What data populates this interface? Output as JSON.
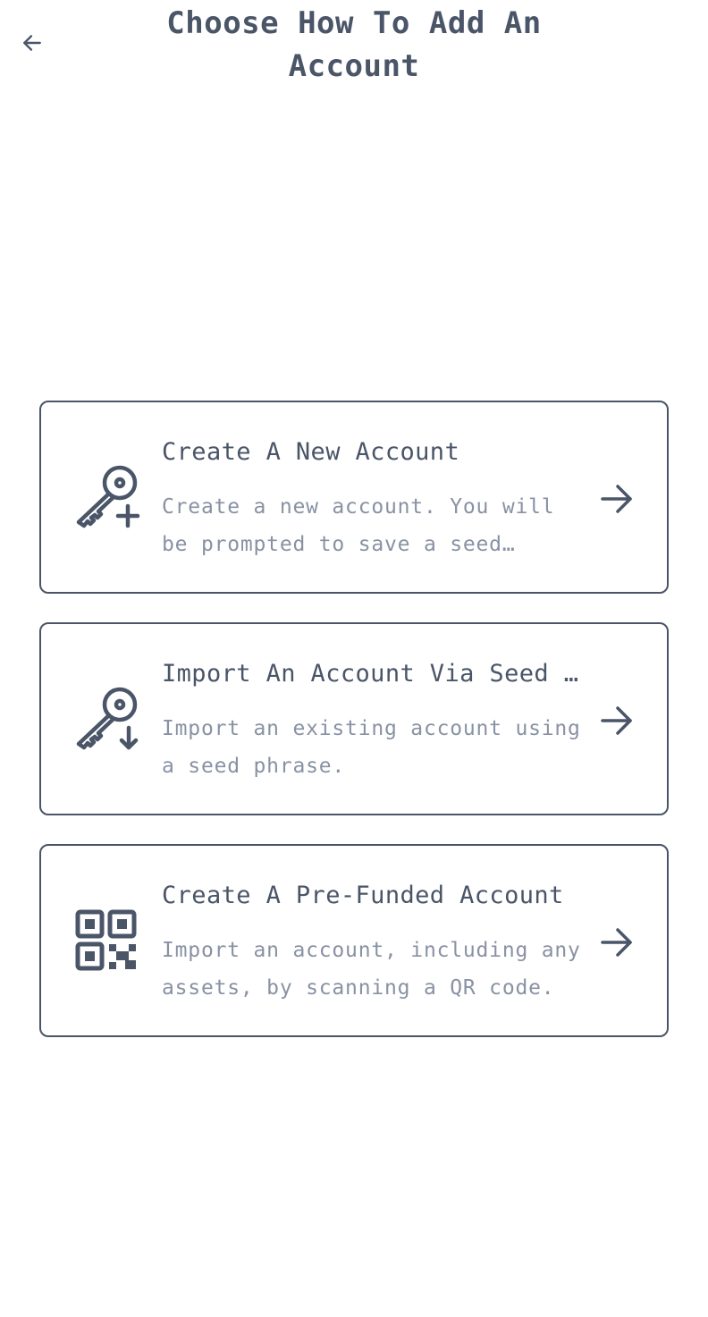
{
  "header": {
    "title": "Choose How To Add An Account"
  },
  "options": [
    {
      "title": "Create A New Account",
      "description": "Create a new account. You will be prompted to save a seed phrase.",
      "icon": "key-plus-icon"
    },
    {
      "title": "Import An Account Via Seed Phrase",
      "description": "Import an existing account using a seed phrase.",
      "icon": "key-download-icon"
    },
    {
      "title": "Create A Pre-Funded Account",
      "description": "Import an account, including any assets, by scanning a QR code.",
      "icon": "qr-code-icon"
    }
  ],
  "colors": {
    "primary": "#4a5568",
    "muted": "#8892a3"
  }
}
